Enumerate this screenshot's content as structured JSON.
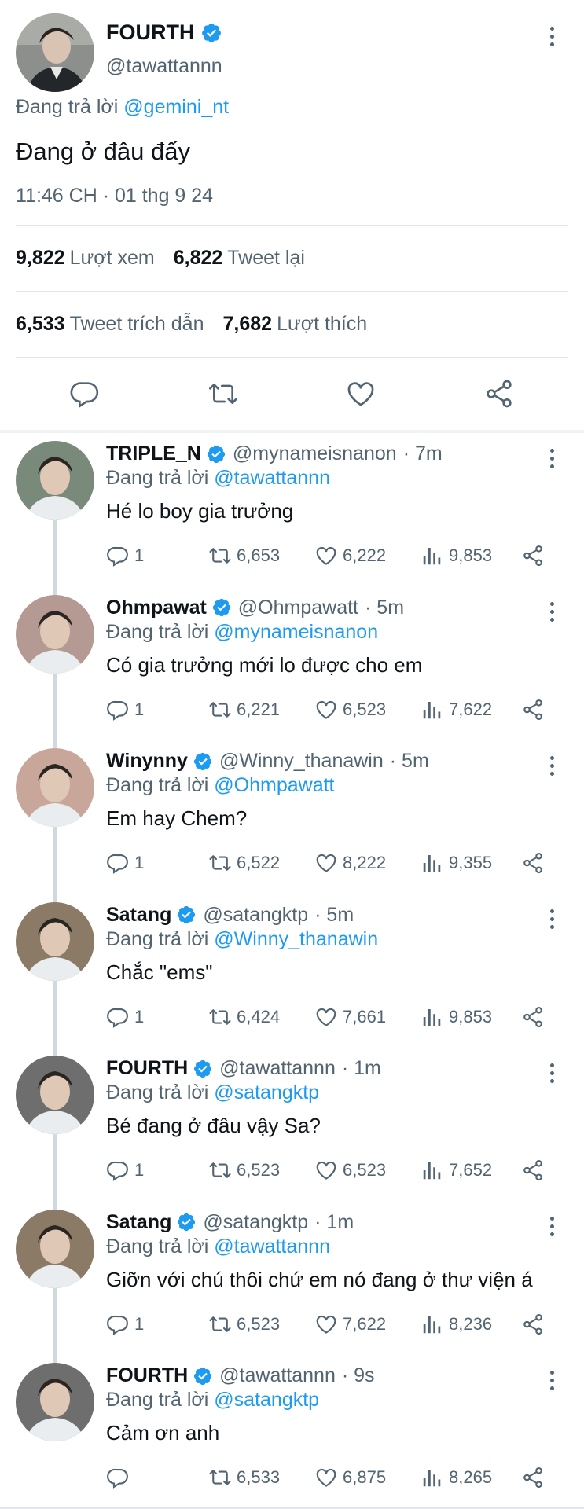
{
  "main_tweet": {
    "name": "FOURTH",
    "handle": "@tawattannn",
    "replying_prefix": "Đang trả lời",
    "replying_to": "@gemini_nt",
    "text": "Đang ở đâu đấy",
    "timestamp": "11:46 CH · 01 thg 9 24",
    "views_count": "9,822",
    "views_label": "Lượt xem",
    "retweets_count": "6,822",
    "retweets_label": "Tweet lại",
    "quotes_count": "6,533",
    "quotes_label": "Tweet trích dẫn",
    "likes_count": "7,682",
    "likes_label": "Lượt thích"
  },
  "replies": [
    {
      "name": "TRIPLE_N",
      "handle": "@mynameisnanon",
      "time": "· 7m",
      "replying_prefix": "Đang trả lời",
      "replying_to": "@tawattannn",
      "text": "Hé lo boy gia trưởng",
      "replies": "1",
      "retweets": "6,653",
      "likes": "6,222",
      "views": "9,853",
      "avatar_color": "#7a8a7a"
    },
    {
      "name": "Ohmpawat",
      "handle": "@Ohmpawatt",
      "time": "· 5m",
      "replying_prefix": "Đang trả lời",
      "replying_to": "@mynameisnanon",
      "text": "Có gia trưởng mới lo được cho em",
      "replies": "1",
      "retweets": "6,221",
      "likes": "6,523",
      "views": "7,622",
      "avatar_color": "#b59a94"
    },
    {
      "name": "Winynny",
      "handle": "@Winny_thanawin",
      "time": "· 5m",
      "replying_prefix": "Đang trả lời",
      "replying_to": "@Ohmpawatt",
      "text": "Em hay Chem?",
      "replies": "1",
      "retweets": "6,522",
      "likes": "8,222",
      "views": "9,355",
      "avatar_color": "#c8a79a"
    },
    {
      "name": "Satang",
      "handle": "@satangktp",
      "time": "· 5m",
      "replying_prefix": "Đang trả lời",
      "replying_to": "@Winny_thanawin",
      "text": "Chắc \"ems\"",
      "replies": "1",
      "retweets": "6,424",
      "likes": "7,661",
      "views": "9,853",
      "avatar_color": "#8a7a66"
    },
    {
      "name": "FOURTH",
      "handle": "@tawattannn",
      "time": "· 1m",
      "replying_prefix": "Đang trả lời",
      "replying_to": "@satangktp",
      "text": "Bé đang ở đâu vậy Sa?",
      "replies": "1",
      "retweets": "6,523",
      "likes": "6,523",
      "views": "7,652",
      "avatar_color": "#6e6e6e"
    },
    {
      "name": "Satang",
      "handle": "@satangktp",
      "time": "· 1m",
      "replying_prefix": "Đang trả lời",
      "replying_to": "@tawattannn",
      "text": "Giỡn với chú thôi chứ em nó đang ở thư viện á",
      "replies": "1",
      "retweets": "6,523",
      "likes": "7,622",
      "views": "8,236",
      "avatar_color": "#8a7a66"
    },
    {
      "name": "FOURTH",
      "handle": "@tawattannn",
      "time": "· 9s",
      "replying_prefix": "Đang trả lời",
      "replying_to": "@satangktp",
      "text": "Cảm ơn anh",
      "replies": "",
      "retweets": "6,533",
      "likes": "6,875",
      "views": "8,265",
      "avatar_color": "#6e6e6e"
    }
  ],
  "icons": {
    "verified": "verified-badge-icon",
    "more": "more-vertical-icon",
    "reply": "reply-icon",
    "retweet": "retweet-icon",
    "like": "heart-icon",
    "views": "views-bar-icon",
    "share": "share-icon"
  },
  "colors": {
    "accent": "#1d9bf0",
    "text": "#0f1419",
    "secondary": "#536471"
  }
}
